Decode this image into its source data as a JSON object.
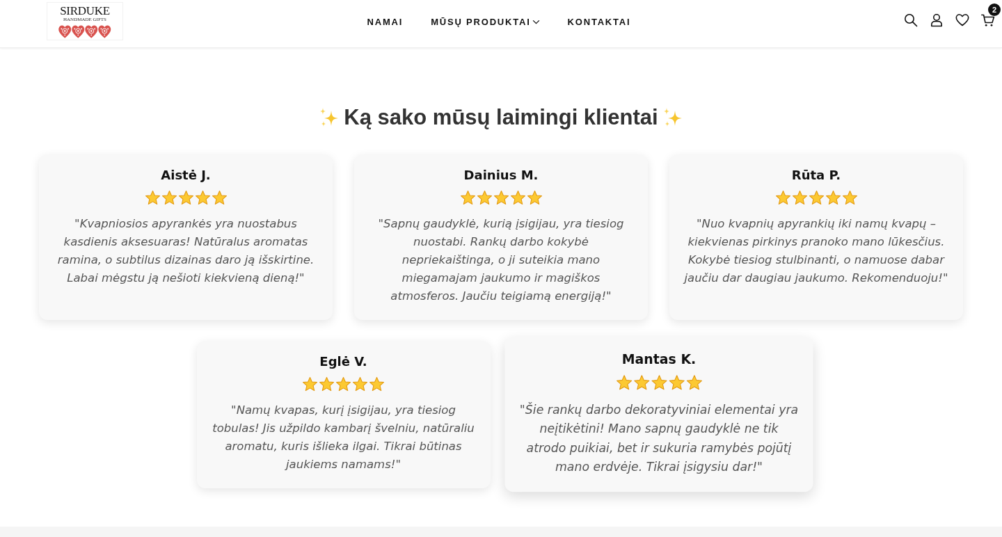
{
  "header": {
    "logo": {
      "title": "SIRDUKE",
      "subtitle": "HANDMADE GIFTS"
    },
    "nav": [
      {
        "label": "NAMAI",
        "dropdown": false
      },
      {
        "label": "MŪSŲ PRODUKTAI",
        "dropdown": true
      },
      {
        "label": "KONTAKTAI",
        "dropdown": false
      }
    ],
    "cart_count": "2"
  },
  "testimonials": {
    "title": "Ką sako mūsų laimingi klientai",
    "reviews": [
      {
        "name": "Aistė J.",
        "stars": 5,
        "hovered": false,
        "quote": "\"Kvapniosios apyrankės yra nuostabus kasdienis aksesuaras! Natūralus aromatas ramina, o subtilus dizainas daro ją išskirtine. Labai mėgstu ją nešioti kiekvieną dieną!\""
      },
      {
        "name": "Dainius M.",
        "stars": 5,
        "hovered": false,
        "quote": "\"Sapnų gaudyklė, kurią įsigijau, yra tiesiog nuostabi. Rankų darbo kokybė nepriekaištinga, o ji suteikia mano miegamajam jaukumo ir magiškos atmosferos. Jaučiu teigiamą energiją!\""
      },
      {
        "name": "Rūta P.",
        "stars": 5,
        "hovered": false,
        "quote": "\"Nuo kvapnių apyrankių iki namų kvapų – kiekvienas pirkinys pranoko mano lūkesčius. Kokybė tiesiog stulbinanti, o namuose dabar jaučiu dar daugiau jaukumo. Rekomenduoju!\""
      },
      {
        "name": "Eglė V.",
        "stars": 5,
        "hovered": false,
        "quote": "\"Namų kvapas, kurį įsigijau, yra tiesiog tobulas! Jis užpildo kambarį švelniu, natūraliu aromatu, kuris išlieka ilgai. Tikrai būtinas jaukiems namams!\""
      },
      {
        "name": "Mantas K.",
        "stars": 5,
        "hovered": true,
        "quote": "\"Šie rankų darbo dekoratyviniai elementai yra neįtikėtini! Mano sapnų gaudyklė ne tik atrodo puikiai, bet ir sukuria ramybės pojūtį mano erdvėje. Tikrai įsigysiu dar!\""
      }
    ]
  }
}
